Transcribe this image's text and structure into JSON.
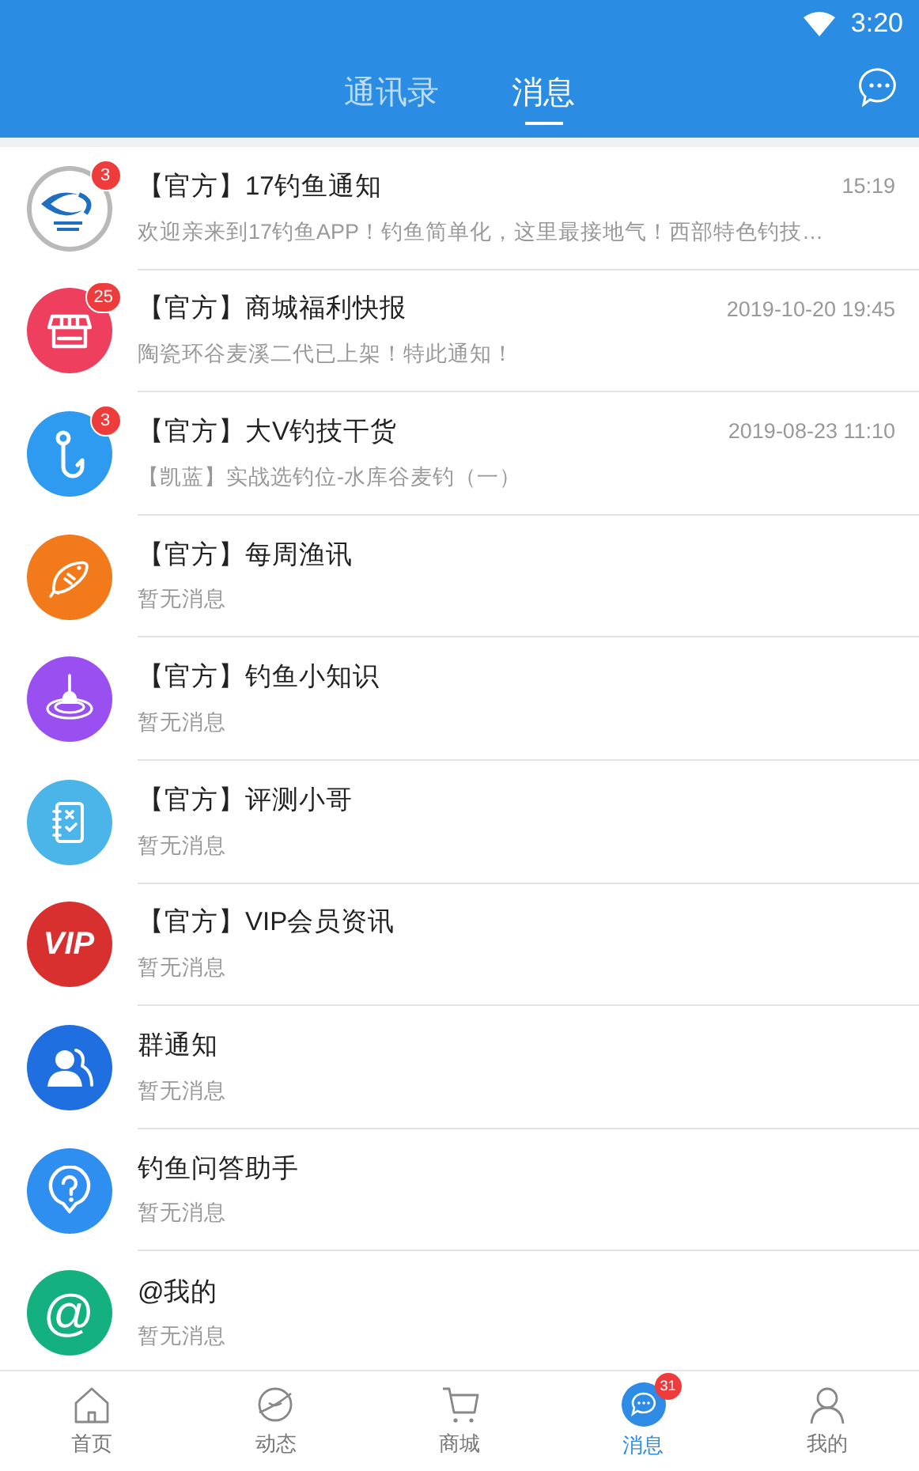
{
  "status_bar": {
    "time": "3:20"
  },
  "tabs": [
    {
      "label": "通讯录",
      "selected": false
    },
    {
      "label": "消息",
      "selected": true
    }
  ],
  "conversations": [
    {
      "kind": "logo",
      "color": "#ffffff",
      "title": "【官方】17钓鱼通知",
      "time": "15:19",
      "preview": "欢迎亲来到17钓鱼APP！钓鱼简单化，这里最接地气！西部特色钓技…",
      "badge": "3"
    },
    {
      "kind": "shop",
      "color": "#ee3f5f",
      "title": "【官方】商城福利快报",
      "time": "2019-10-20 19:45",
      "preview": "陶瓷环谷麦溪二代已上架！特此通知！",
      "badge": "25"
    },
    {
      "kind": "hook",
      "color": "#2e9bf0",
      "title": "【官方】大V钓技干货",
      "time": "2019-08-23 11:10",
      "preview": "【凯蓝】实战选钓位-水库谷麦钓（一）",
      "badge": "3"
    },
    {
      "kind": "fish",
      "color": "#f27a1a",
      "title": "【官方】每周渔讯",
      "preview": "暂无消息"
    },
    {
      "kind": "float",
      "color": "#9a4ff0",
      "title": "【官方】钓鱼小知识",
      "preview": "暂无消息"
    },
    {
      "kind": "checklist",
      "color": "#4bb5ea",
      "title": "【官方】评测小哥",
      "preview": "暂无消息"
    },
    {
      "kind": "vip",
      "color": "#d8302f",
      "avatar_text": "VIP",
      "title": "【官方】VIP会员资讯",
      "preview": "暂无消息"
    },
    {
      "kind": "group",
      "color": "#1f6fe0",
      "title": "群通知",
      "preview": "暂无消息"
    },
    {
      "kind": "question",
      "color": "#2f8ff0",
      "title": "钓鱼问答助手",
      "preview": "暂无消息"
    },
    {
      "kind": "at",
      "color": "#14b07f",
      "avatar_text": "@",
      "title": "@我的",
      "preview": "暂无消息"
    }
  ],
  "bottom_nav": [
    {
      "kind": "home",
      "label": "首页",
      "selected": false
    },
    {
      "kind": "planet",
      "label": "动态",
      "selected": false
    },
    {
      "kind": "cart",
      "label": "商城",
      "selected": false
    },
    {
      "kind": "chat",
      "label": "消息",
      "selected": true,
      "badge": "31"
    },
    {
      "kind": "person",
      "label": "我的",
      "selected": false
    }
  ]
}
